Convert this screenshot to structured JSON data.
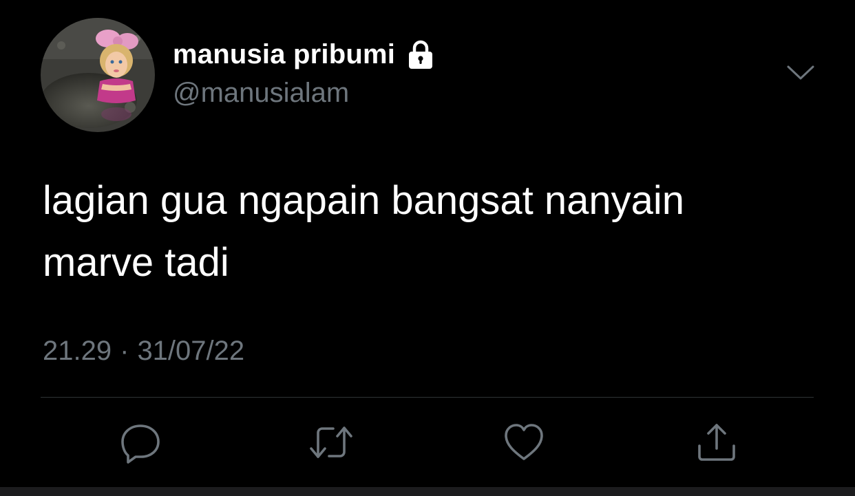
{
  "author": {
    "display_name": "manusia pribumi",
    "handle": "@manusialam",
    "protected": true,
    "avatar": "doll-head-with-pink-bow-icon"
  },
  "tweet": {
    "text": "lagian gua ngapain bangsat nanyain\nmarve tadi",
    "time": "21.29",
    "separator": "·",
    "date": "31/07/22"
  },
  "actions": [
    {
      "name": "reply",
      "icon": "reply-bubble-icon"
    },
    {
      "name": "retweet",
      "icon": "retweet-arrows-icon"
    },
    {
      "name": "like",
      "icon": "heart-icon"
    },
    {
      "name": "share",
      "icon": "share-upload-icon"
    }
  ],
  "colors": {
    "background": "#000000",
    "primary_text": "#ffffff",
    "secondary_text": "#6e767d",
    "divider": "#2f3336",
    "icon": "#6e767d"
  }
}
